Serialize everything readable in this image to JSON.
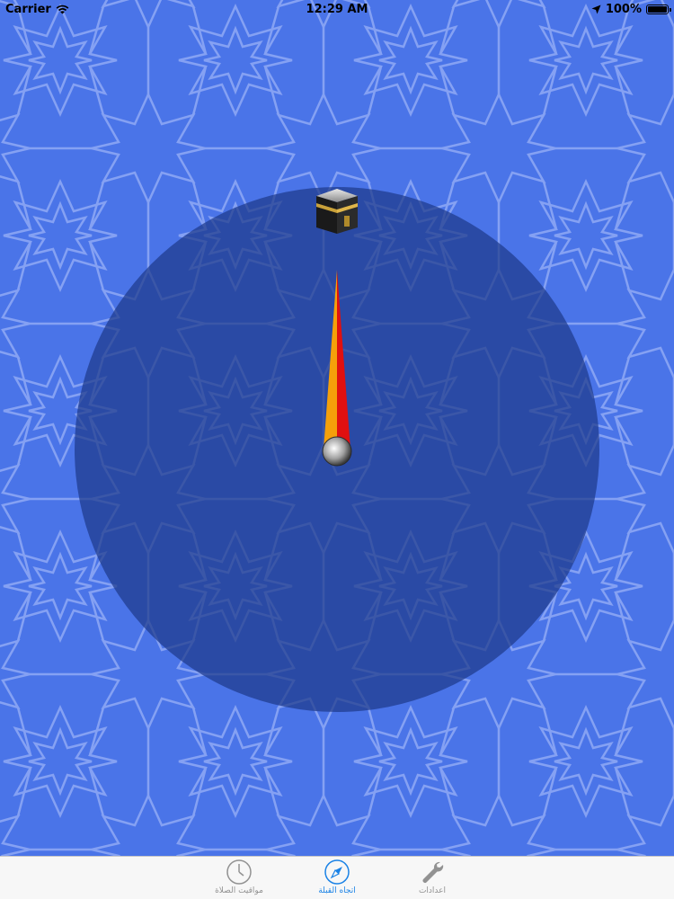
{
  "status_bar": {
    "carrier": "Carrier",
    "time": "12:29 AM",
    "battery": "100%"
  },
  "compass": {
    "qibla_bearing_deg": 0,
    "background_color": "#4a74e8",
    "dial_color": "#23408f"
  },
  "tab_bar": {
    "tabs": [
      {
        "label": "مواقيت الصلاة",
        "icon": "clock-icon",
        "active": false
      },
      {
        "label": "اتجاه القبلة",
        "icon": "compass-icon",
        "active": true
      },
      {
        "label": "اعدادات",
        "icon": "wrench-icon",
        "active": false
      }
    ]
  }
}
